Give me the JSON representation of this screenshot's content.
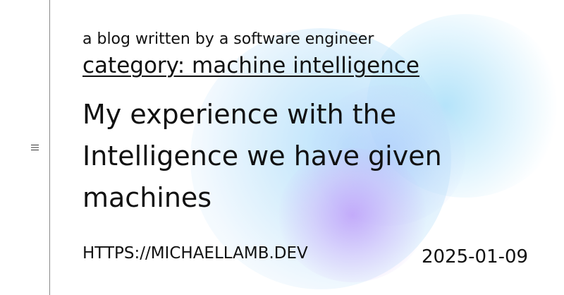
{
  "sidebar": {
    "menu_icon": "hamburger-menu-icon"
  },
  "header": {
    "tagline": "a blog written by a software engineer",
    "category": "category: machine intelligence"
  },
  "post": {
    "title": "My experience with the Intelligence we have given machines",
    "date": "2025-01-09"
  },
  "footer": {
    "url": "HTTPS://MICHAELLAMB.DEV"
  },
  "colors": {
    "text": "#111111",
    "rail": "#8a8a8a",
    "glow_blue": "#a0d7fa",
    "glow_purple": "#be96fa",
    "background": "#ffffff"
  }
}
